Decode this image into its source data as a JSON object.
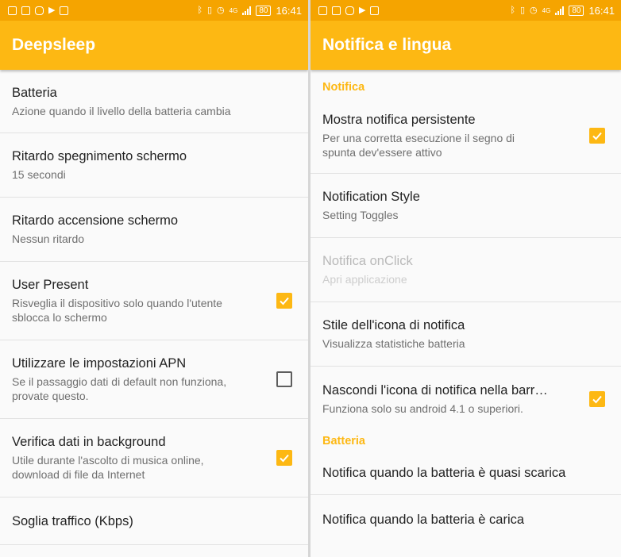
{
  "status_bar": {
    "time": "16:41",
    "battery": "80",
    "network": "4G"
  },
  "left": {
    "title": "Deepsleep",
    "items": [
      {
        "title": "Batteria",
        "summary": "Azione quando il livello della batteria cambia"
      },
      {
        "title": "Ritardo spegnimento schermo",
        "summary": "15 secondi"
      },
      {
        "title": "Ritardo accensione schermo",
        "summary": "Nessun ritardo"
      },
      {
        "title": "User Present",
        "summary_lines": [
          "Risveglia il dispositivo solo quando l'utente",
          "sblocca lo schermo"
        ],
        "checked": true
      },
      {
        "title": "Utilizzare le impostazioni APN",
        "summary_lines": [
          "Se il passaggio dati di default non funziona,",
          "provate questo."
        ],
        "checked": false
      },
      {
        "title": "Verifica dati in background",
        "summary_lines": [
          "Utile durante l'ascolto di musica online,",
          "download di file da Internet"
        ],
        "checked": true
      },
      {
        "title": "Soglia traffico (Kbps)"
      }
    ]
  },
  "right": {
    "title": "Notifica e lingua",
    "categories": {
      "notification": "Notifica",
      "battery": "Batteria"
    },
    "items": [
      {
        "title": "Mostra notifica persistente",
        "summary_lines": [
          "Per una corretta esecuzione il segno di",
          "spunta dev'essere attivo"
        ],
        "checked": true
      },
      {
        "title": "Notification Style",
        "summary": "Setting Toggles"
      },
      {
        "title": "Notifica onClick",
        "summary": "Apri applicazione",
        "enabled": false
      },
      {
        "title": "Stile dell'icona di notifica",
        "summary": "Visualizza statistiche batteria"
      },
      {
        "title": "Nascondi l'icona di notifica nella barr…",
        "summary": "Funziona solo su android 4.1 o superiori.",
        "checked": true
      },
      {
        "title": "Notifica quando la batteria è quasi scarica"
      },
      {
        "title": "Notifica quando la batteria è carica"
      }
    ]
  },
  "colors": {
    "accent": "#fdb813",
    "status_bar": "#f5a400"
  },
  "icons": [
    "bluetooth-icon",
    "vibrate-icon",
    "alarm-icon",
    "signal-icon",
    "battery-icon",
    "checkmark-icon"
  ]
}
